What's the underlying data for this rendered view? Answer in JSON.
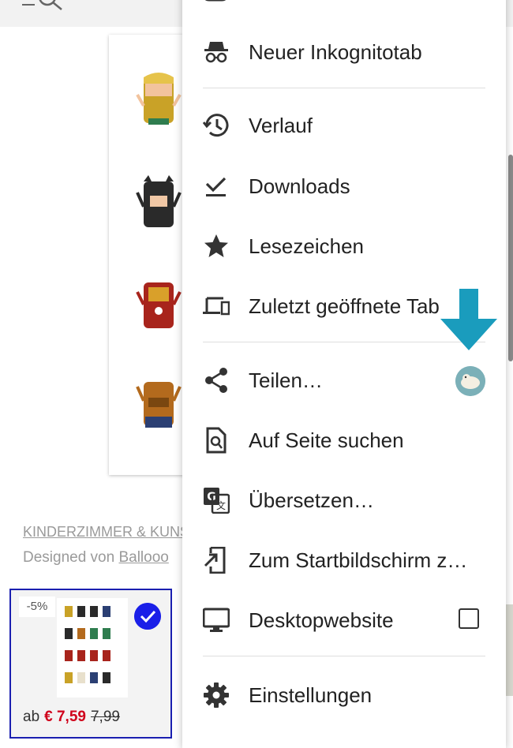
{
  "page": {
    "link_text": "KINDERZIMMER & KUNST",
    "designer_prefix": "Designed von ",
    "designer_name": "Ballooo",
    "product": {
      "discount_badge": "-5%",
      "price_prefix": "ab",
      "price_new": "€ 7,59",
      "price_old": "7,99"
    }
  },
  "menu": {
    "items": [
      {
        "label": "Neuer Inkognitotab",
        "icon": "incognito-icon"
      },
      {
        "label": "Verlauf",
        "icon": "history-icon"
      },
      {
        "label": "Downloads",
        "icon": "download-check-icon"
      },
      {
        "label": "Lesezeichen",
        "icon": "star-icon"
      },
      {
        "label": "Zuletzt geöffnete Tab",
        "icon": "devices-icon"
      },
      {
        "label": "Teilen…",
        "icon": "share-icon"
      },
      {
        "label": "Auf Seite suchen",
        "icon": "find-in-page-icon"
      },
      {
        "label": "Übersetzen…",
        "icon": "translate-icon"
      },
      {
        "label": "Zum Startbildschirm z…",
        "icon": "add-to-home-icon"
      },
      {
        "label": "Desktopwebsite",
        "icon": "desktop-icon"
      },
      {
        "label": "Einstellungen",
        "icon": "gear-icon"
      }
    ],
    "desktop_site_checked": false
  },
  "colors": {
    "accent_arrow": "#1a9cbd",
    "price_red": "#d0021b",
    "card_border": "#1a1fb0",
    "check_blue": "#1a1fe8"
  }
}
